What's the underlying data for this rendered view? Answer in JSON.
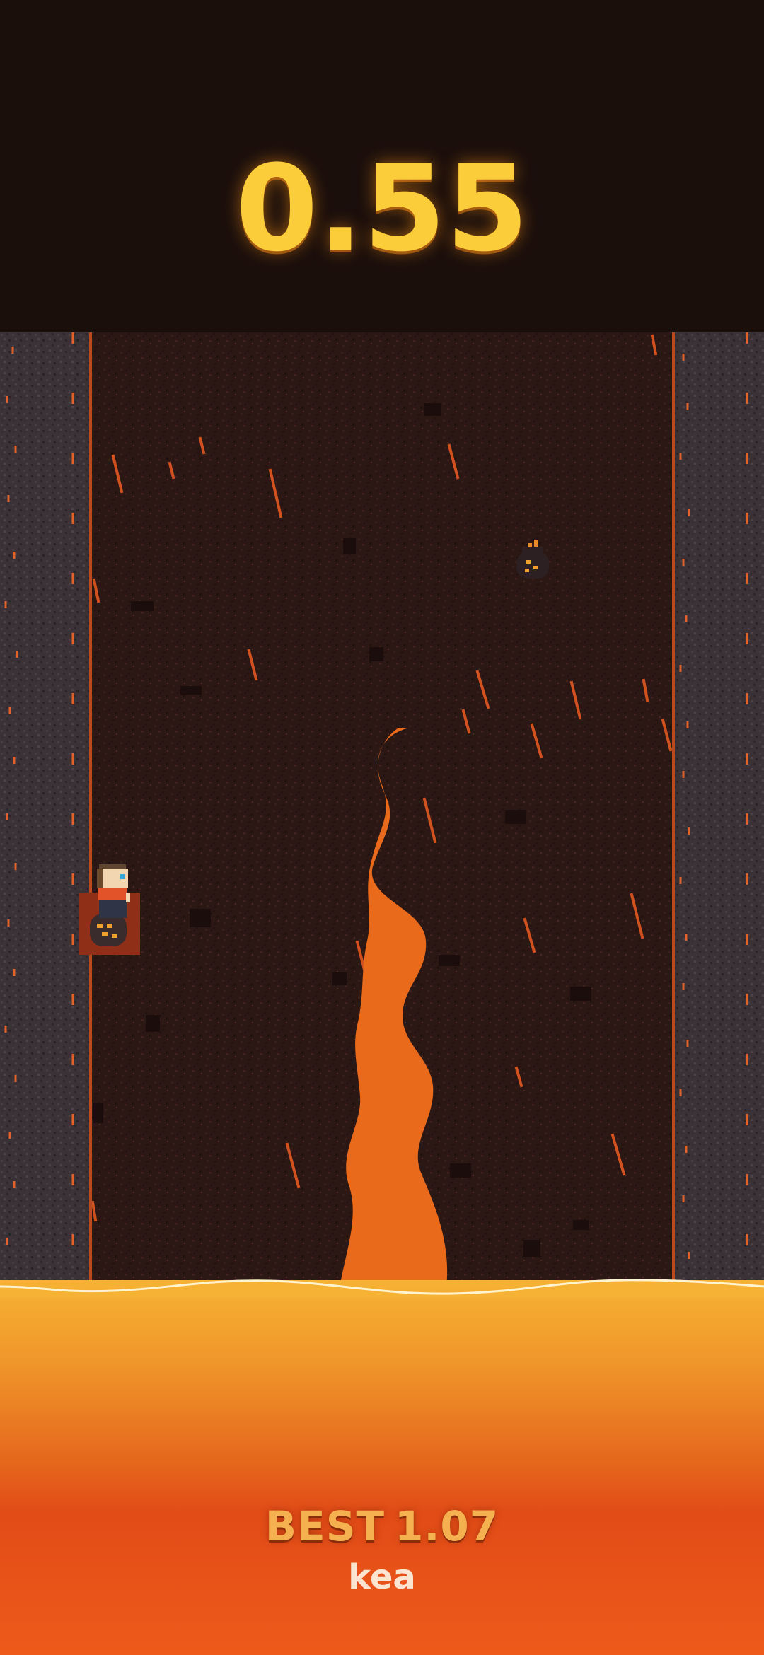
{
  "hud": {
    "score": "0.55"
  },
  "footer": {
    "best_label": "BEST",
    "best_value": "1.07",
    "player_name": "kea"
  },
  "colors": {
    "background": "#1b0f0c",
    "shaft_rock": "#2b1714",
    "wall_stone": "#3a3236",
    "ember": "#e0612a",
    "lava_stream": "#ea6a1c",
    "lava_top": "#f6b234",
    "lava_bottom": "#e24c17",
    "score_text": "#fbcd3b",
    "best_text": "#f5b14f",
    "name_text": "#fbe4d0"
  },
  "icons": {
    "player": "miner-character-sprite",
    "platform": "lava-rock-ledge",
    "hazard": "falling-lava-rock",
    "stream": "lava-stream"
  }
}
